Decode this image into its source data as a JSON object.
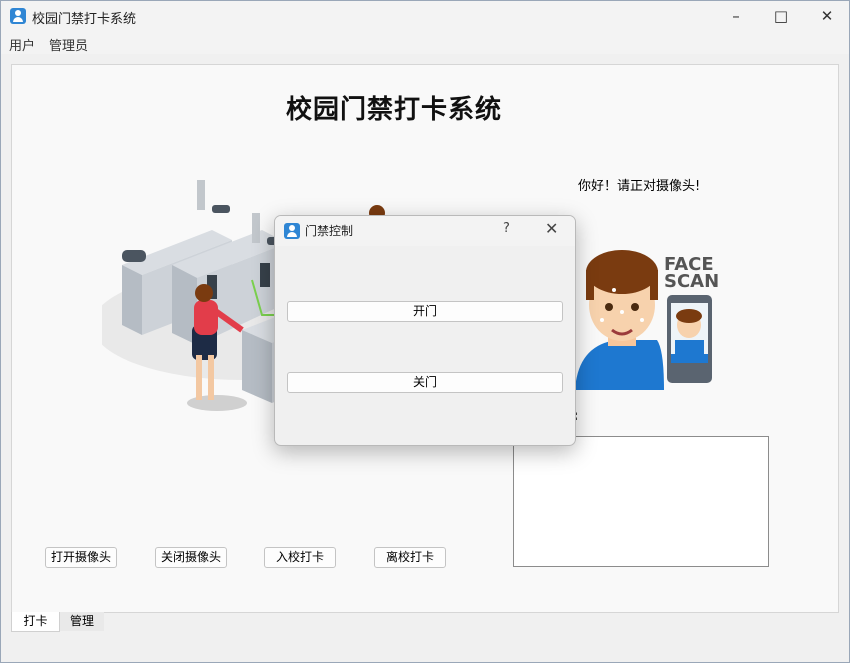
{
  "window": {
    "title": "校园门禁打卡系统"
  },
  "menu": {
    "items": [
      "用户",
      "管理员"
    ]
  },
  "main": {
    "title": "校园门禁打卡系统",
    "greeting": "你好！请正对摄像头!",
    "face_scan_text": [
      "FACE",
      "SCAN"
    ],
    "colon": ":",
    "buttons": [
      "打开摄像头",
      "关闭摄像头",
      "入校打卡",
      "离校打卡"
    ]
  },
  "tabs": [
    {
      "label": "打卡",
      "active": true
    },
    {
      "label": "管理",
      "active": false
    }
  ],
  "dialog": {
    "title": "门禁控制",
    "help": "?",
    "open_label": "开门",
    "close_label": "关门"
  },
  "colors": {
    "accent": "#2f86d4",
    "shirt": "#1e78d0",
    "hair": "#7a3b10"
  }
}
